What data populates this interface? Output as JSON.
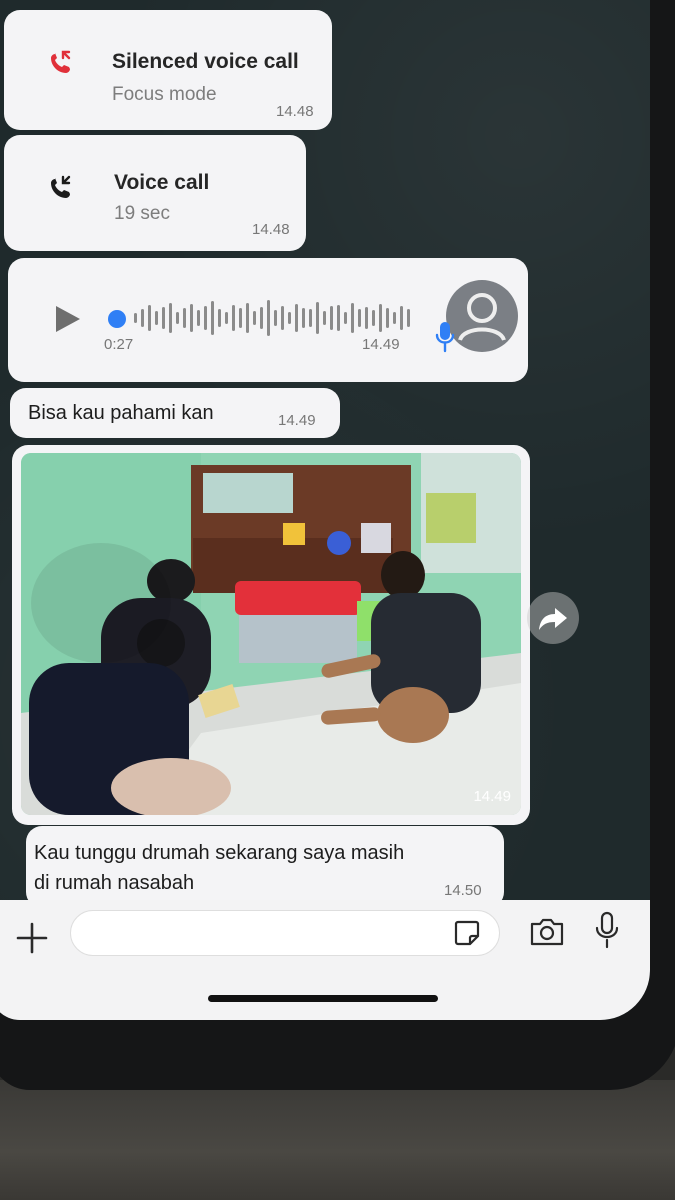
{
  "messages": {
    "silenced_call": {
      "title": "Silenced voice call",
      "subtitle": "Focus mode",
      "time": "14.48",
      "icon": "missed-call-icon",
      "icon_color": "#e0303a"
    },
    "voice_call": {
      "title": "Voice call",
      "subtitle": "19 sec",
      "time": "14.48",
      "icon": "incoming-call-icon"
    },
    "voice_note": {
      "duration": "0:27",
      "time": "14.49",
      "accent": "#2f7ff5"
    },
    "text1": {
      "text": "Bisa kau pahami kan",
      "time": "14.49"
    },
    "photo": {
      "time": "14.49"
    },
    "text2": {
      "line1": "Kau tunggu drumah sekarang saya masih",
      "line2": "di rumah nasabah",
      "time": "14.50"
    }
  },
  "input_bar": {
    "placeholder": ""
  }
}
